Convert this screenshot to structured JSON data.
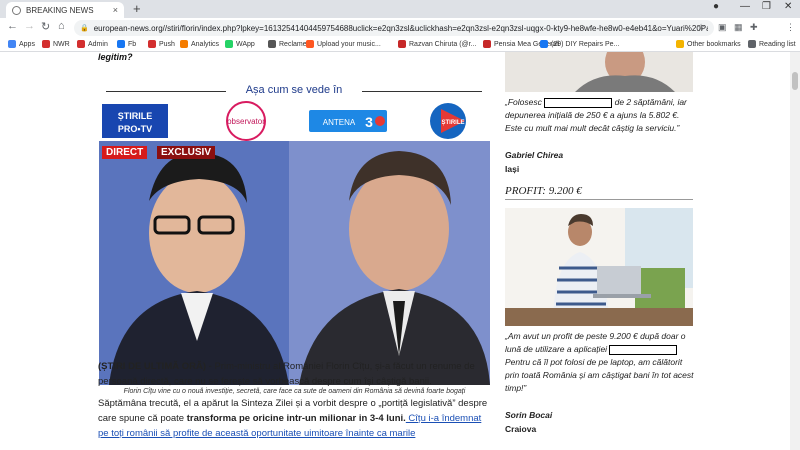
{
  "browser": {
    "tab_title": "BREAKING NEWS",
    "tab_close": "×",
    "new_tab": "+",
    "url": "european-news.org//stiri/florin/index.php?lpkey=16132541404459754688uclick=e2qn3zsl&uclickhash=e2qn3zsl-e2qn3zsl-uqgx-0-kty9-he8wfe-he8w0-e4eb41&o=Yuari%20Pay%20Syst...",
    "bookmarks": [
      {
        "label": "Apps",
        "color": "#4285f4"
      },
      {
        "label": "NWR",
        "color": "#d32f2f"
      },
      {
        "label": "Admin",
        "color": "#d32f2f"
      },
      {
        "label": "Fb",
        "color": "#1877f2"
      },
      {
        "label": "Push",
        "color": "#d32f2f"
      },
      {
        "label": "Analytics",
        "color": "#f57c00"
      },
      {
        "label": "WApp",
        "color": "#25d366"
      },
      {
        "label": "Reclame",
        "color": "#555555"
      },
      {
        "label": "Upload your music...",
        "color": "#ff5722"
      },
      {
        "label": "Razvan Chiruta (@r...",
        "color": "#c62828"
      },
      {
        "label": "Pensia Mea Generali",
        "color": "#c62828"
      },
      {
        "label": "(29) DIY Repairs Pe...",
        "color": "#1877f2"
      },
      {
        "label": "Other bookmarks",
        "color": "#f4b400"
      },
      {
        "label": "Reading list",
        "color": "#5f6368"
      }
    ]
  },
  "article": {
    "lead_fragment": "legitim?",
    "brands_title": "Așa cum se vede în",
    "brands": [
      "ȘTIRILE PRO TV",
      "observator",
      "ANTENA 3",
      "ȘTIRILE TVR"
    ],
    "photo_tags": [
      "DIRECT",
      "EXCLUSIV"
    ],
    "caption": "Florin Cîțu vine cu o nouă investiție, secretă, care face ca sute de oameni din România să devină foarte bogați",
    "p1_bold": "(ȘTIRI DE ULTIMĂ ORĂ)",
    "p1_rest": " - Prim-ministru al României Florin Cîțu, și-a făcut un renume de persoană directă, care nu se ferește să vorbească despre cum își câștigă banii.",
    "p2_a": "Săptămâna trecută, el a apărut la Sinteza Zilei și a vorbit despre o „portiță legislativă” despre care spune că poate ",
    "p2_bold": "transforma pe oricine intr-un milionar in 3-4 luni.",
    "p2_link": " Cîțu i-a îndemnat pe toți românii să profite de această oportunitate uimitoare înainte ca marile"
  },
  "sidebar": {
    "quote1_a": "„Folosesc",
    "quote1_b": "de 2 săptămâni, iar depunerea inițială de 250 € a ajuns la 5.802 €. Este cu mult mai mult decât câștig la serviciu.”",
    "author1": "Gabriel Chirea",
    "city1": "Iași",
    "profit": "PROFIT: 9.200 €",
    "quote2_a": "„Am avut un profit de peste 9.200 € după doar o lună de utilizare a aplicației",
    "quote2_b": "Pentru că îl pot folosi de pe laptop, am călătorit prin toată România și am câștigat bani în tot acest timp!”",
    "author2": "Sorin Bocai",
    "city2": "Craiova"
  },
  "colors": {
    "link": "#1a4fb5",
    "heading_blue": "#1e3a8a"
  }
}
